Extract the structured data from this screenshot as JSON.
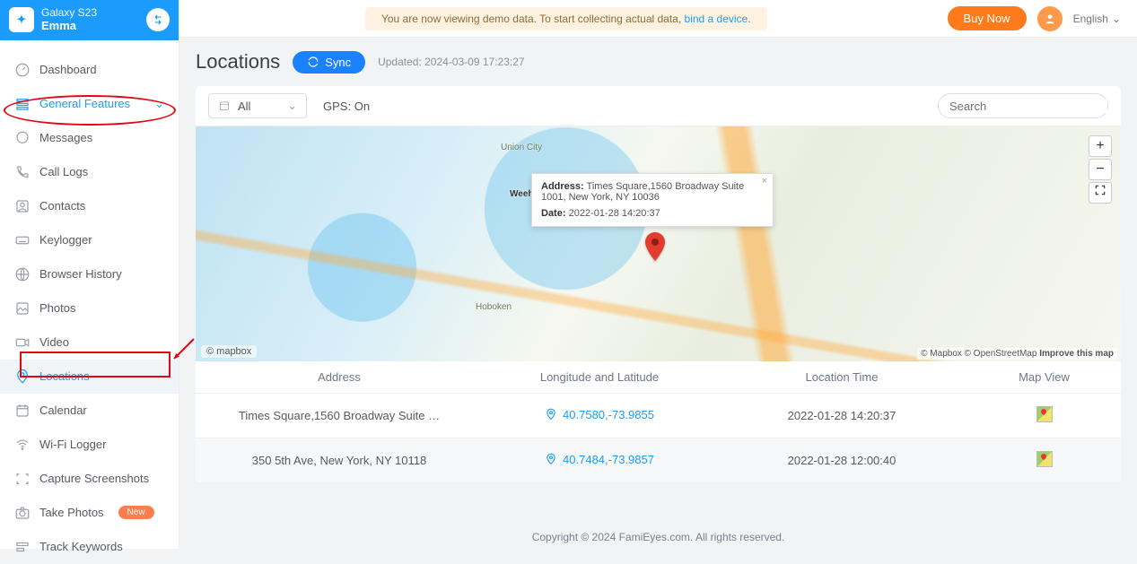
{
  "sidebar": {
    "device": "Galaxy S23",
    "user": "Emma",
    "items": [
      {
        "label": "Dashboard"
      },
      {
        "label": "General Features",
        "section": true
      },
      {
        "label": "Messages"
      },
      {
        "label": "Call Logs"
      },
      {
        "label": "Contacts"
      },
      {
        "label": "Keylogger"
      },
      {
        "label": "Browser History"
      },
      {
        "label": "Photos"
      },
      {
        "label": "Video"
      },
      {
        "label": "Locations",
        "active": true
      },
      {
        "label": "Calendar"
      },
      {
        "label": "Wi-Fi Logger"
      },
      {
        "label": "Capture Screenshots"
      },
      {
        "label": "Take Photos",
        "badge": "New"
      },
      {
        "label": "Track Keywords"
      }
    ]
  },
  "topbar": {
    "demo_prefix": "You are now viewing demo data. To start collecting actual data, ",
    "demo_link": "bind a device",
    "buy": "Buy Now",
    "lang": "English"
  },
  "page": {
    "title": "Locations",
    "sync": "Sync",
    "updated": "Updated: 2024-03-09 17:23:27",
    "filter_value": "All",
    "gps_label": "GPS:",
    "gps_value": "On",
    "search_placeholder": "Search"
  },
  "map": {
    "info_address_label": "Address:",
    "info_address_value": "Times Square,1560 Broadway Suite 1001, New York, NY 10036",
    "info_date_label": "Date:",
    "info_date_value": "2022-01-28 14:20:37",
    "labels": {
      "union_city": "Union City",
      "hoboken": "Hoboken",
      "weeh": "Weeh"
    },
    "attrib_prefix": "© Mapbox © OpenStreetMap ",
    "attrib_link": "Improve this map",
    "mapbox": "© mapbox"
  },
  "table": {
    "headers": {
      "address": "Address",
      "ll": "Longitude and Latitude",
      "time": "Location Time",
      "view": "Map View"
    },
    "rows": [
      {
        "address": "Times Square,1560 Broadway Suite …",
        "ll": "40.7580,-73.9855",
        "time": "2022-01-28 14:20:37"
      },
      {
        "address": "350 5th Ave, New York, NY 10118",
        "ll": "40.7484,-73.9857",
        "time": "2022-01-28 12:00:40"
      }
    ]
  },
  "footer": "Copyright © 2024 FamiEyes.com. All rights reserved."
}
